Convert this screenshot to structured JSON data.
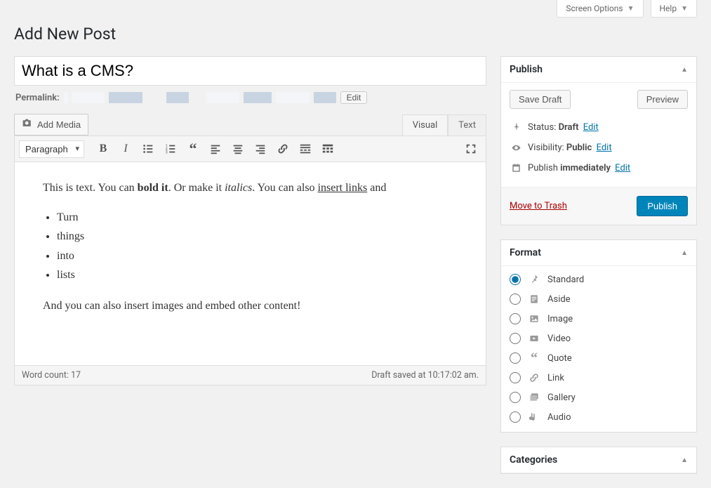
{
  "screen_options": {
    "label": "Screen Options"
  },
  "help": {
    "label": "Help"
  },
  "page_title": "Add New Post",
  "post": {
    "title": "What is a CMS?",
    "permalink_label": "Permalink:",
    "permalink_edit": "Edit"
  },
  "media_button": "Add Media",
  "editor_tabs": {
    "visual": "Visual",
    "text": "Text"
  },
  "toolbar": {
    "format_select": "Paragraph"
  },
  "content": {
    "p1_a": "This is text. You can ",
    "p1_bold": "bold it",
    "p1_b": ". Or make it ",
    "p1_italic": "italics",
    "p1_c": ". You can also ",
    "p1_link": "insert links",
    "p1_d": " and",
    "list": [
      "Turn",
      "things",
      "into",
      "lists"
    ],
    "p2": "And you can also insert images and embed other content!"
  },
  "statusbar": {
    "word_count_label": "Word count: ",
    "word_count": "17",
    "saved": "Draft saved at 10:17:02 am."
  },
  "publish": {
    "heading": "Publish",
    "save_draft": "Save Draft",
    "preview": "Preview",
    "status_label": "Status:",
    "status_value": "Draft",
    "visibility_label": "Visibility:",
    "visibility_value": "Public",
    "publish_label": "Publish",
    "publish_value": "immediately",
    "edit": "Edit",
    "trash": "Move to Trash",
    "button": "Publish"
  },
  "format": {
    "heading": "Format",
    "options": [
      "Standard",
      "Aside",
      "Image",
      "Video",
      "Quote",
      "Link",
      "Gallery",
      "Audio"
    ]
  },
  "categories": {
    "heading": "Categories"
  }
}
